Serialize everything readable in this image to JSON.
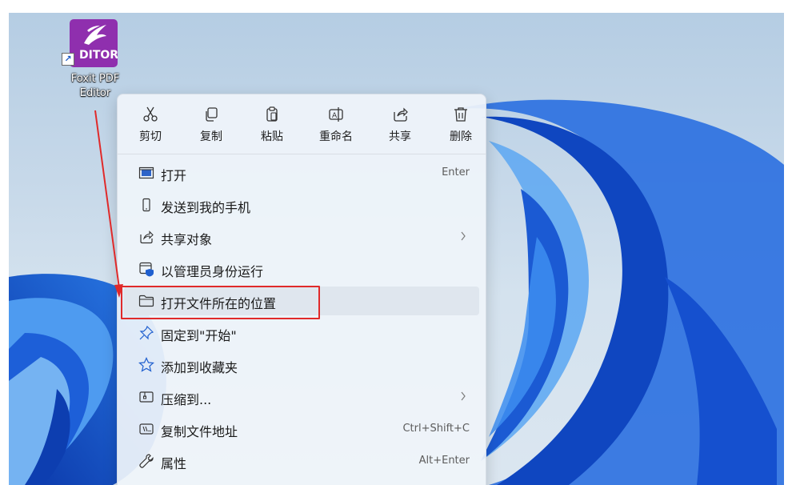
{
  "desktop": {
    "icon_label": "Foxit PDF\nEditor",
    "icon_label_line1": "Foxit PDF",
    "icon_label_line2": "Editor",
    "logo_word": "DITOR",
    "brand_color": "#8f2fae"
  },
  "context_menu": {
    "toolbar": [
      {
        "label": "剪切",
        "icon": "cut-icon"
      },
      {
        "label": "复制",
        "icon": "copy-icon"
      },
      {
        "label": "粘贴",
        "icon": "paste-icon"
      },
      {
        "label": "重命名",
        "icon": "rename-icon"
      },
      {
        "label": "共享",
        "icon": "share-icon"
      },
      {
        "label": "删除",
        "icon": "delete-icon"
      }
    ],
    "items": [
      {
        "label": "打开",
        "shortcut": "Enter",
        "icon": "open-icon",
        "submenu": false
      },
      {
        "label": "发送到我的手机",
        "shortcut": "",
        "icon": "phone-icon",
        "submenu": false
      },
      {
        "label": "共享对象",
        "shortcut": "",
        "icon": "share-icon",
        "submenu": true
      },
      {
        "label": "以管理员身份运行",
        "shortcut": "",
        "icon": "shield-icon",
        "submenu": false
      },
      {
        "label": "打开文件所在的位置",
        "shortcut": "",
        "icon": "folder-icon",
        "submenu": false,
        "highlighted": true
      },
      {
        "label": "固定到\"开始\"",
        "shortcut": "",
        "icon": "pin-icon",
        "submenu": false
      },
      {
        "label": "添加到收藏夹",
        "shortcut": "",
        "icon": "star-icon",
        "submenu": false
      },
      {
        "label": "压缩到...",
        "shortcut": "",
        "icon": "zip-icon",
        "submenu": true
      },
      {
        "label": "复制文件地址",
        "shortcut": "Ctrl+Shift+C",
        "icon": "copy-path-icon",
        "submenu": false
      },
      {
        "label": "属性",
        "shortcut": "Alt+Enter",
        "icon": "wrench-icon",
        "submenu": false
      }
    ]
  },
  "annotation": {
    "color": "#e02a2a"
  },
  "colors": {
    "wallpaper_blue": "#1c5fd6",
    "menu_bg": "#eff4fa",
    "hover_bg": "#dfe6ee"
  }
}
